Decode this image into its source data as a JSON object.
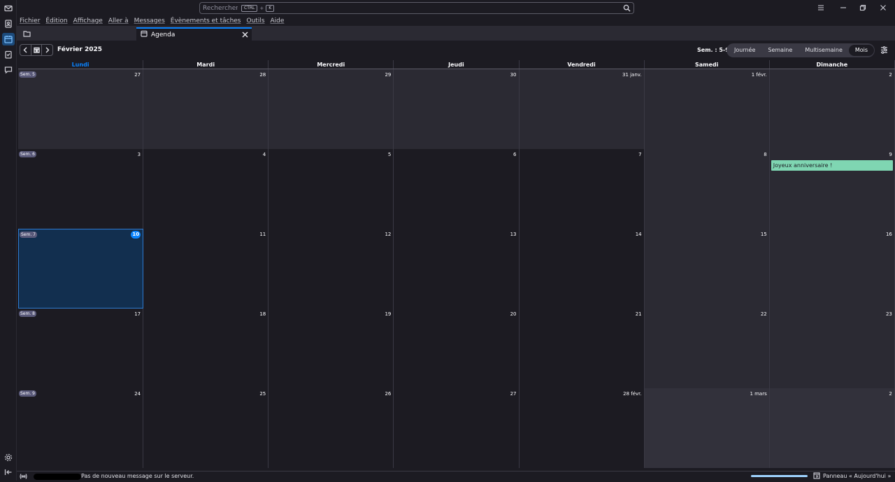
{
  "search": {
    "placeholder": "Rechercher...",
    "shortcut_key": "CTRL",
    "shortcut_plus": "+",
    "shortcut_letter": "K"
  },
  "menu": [
    "Fichier",
    "Édition",
    "Affichage",
    "Aller à",
    "Messages",
    "Évènements et tâches",
    "Outils",
    "Aide"
  ],
  "tabs": {
    "agenda_label": "Agenda"
  },
  "toolbar": {
    "month_label": "Février 2025",
    "weeks_label": "Sem. : 5-9",
    "views": [
      "Journée",
      "Semaine",
      "Multisemaine",
      "Mois"
    ],
    "selected_view": "Mois"
  },
  "calendar": {
    "day_headers": [
      "Lundi",
      "Mardi",
      "Mercredi",
      "Jeudi",
      "Vendredi",
      "Samedi",
      "Dimanche"
    ],
    "today_header_index": 0,
    "weeks": [
      {
        "label": "Sem. 5",
        "days": [
          "27",
          "28",
          "29",
          "30",
          "31 janv.",
          "1 févr.",
          "2"
        ],
        "other_month": [
          true,
          true,
          true,
          true,
          true,
          false,
          false
        ]
      },
      {
        "label": "Sem. 6",
        "days": [
          "3",
          "4",
          "5",
          "6",
          "7",
          "8",
          "9"
        ],
        "other_month": [
          false,
          false,
          false,
          false,
          false,
          false,
          false
        ]
      },
      {
        "label": "Sem. 7",
        "days": [
          "10",
          "11",
          "12",
          "13",
          "14",
          "15",
          "16"
        ],
        "other_month": [
          false,
          false,
          false,
          false,
          false,
          false,
          false
        ]
      },
      {
        "label": "Sem. 8",
        "days": [
          "17",
          "18",
          "19",
          "20",
          "21",
          "22",
          "23"
        ],
        "other_month": [
          false,
          false,
          false,
          false,
          false,
          false,
          false
        ]
      },
      {
        "label": "Sem. 9",
        "days": [
          "24",
          "25",
          "26",
          "27",
          "28 févr.",
          "1 mars",
          "2"
        ],
        "other_month": [
          false,
          false,
          false,
          false,
          false,
          true,
          true
        ]
      }
    ],
    "today": {
      "week": 2,
      "day": 0
    },
    "events": [
      {
        "week": 1,
        "day": 6,
        "title": "Joyeux anniversaire !"
      }
    ]
  },
  "status": {
    "message": "Pas de nouveau message sur le serveur.",
    "progress": 1.0,
    "panel_label": "Panneau « Aujourd'hui »"
  },
  "colors": {
    "accent": "#0a84ff",
    "event": "#7fd6b2",
    "today_cell": "#122f4f"
  },
  "icons": {
    "spaces": [
      "mail-icon",
      "address-book-icon",
      "calendar-icon",
      "tasks-icon",
      "chat-icon"
    ],
    "bottom": [
      "settings-icon",
      "collapse-icon"
    ]
  }
}
